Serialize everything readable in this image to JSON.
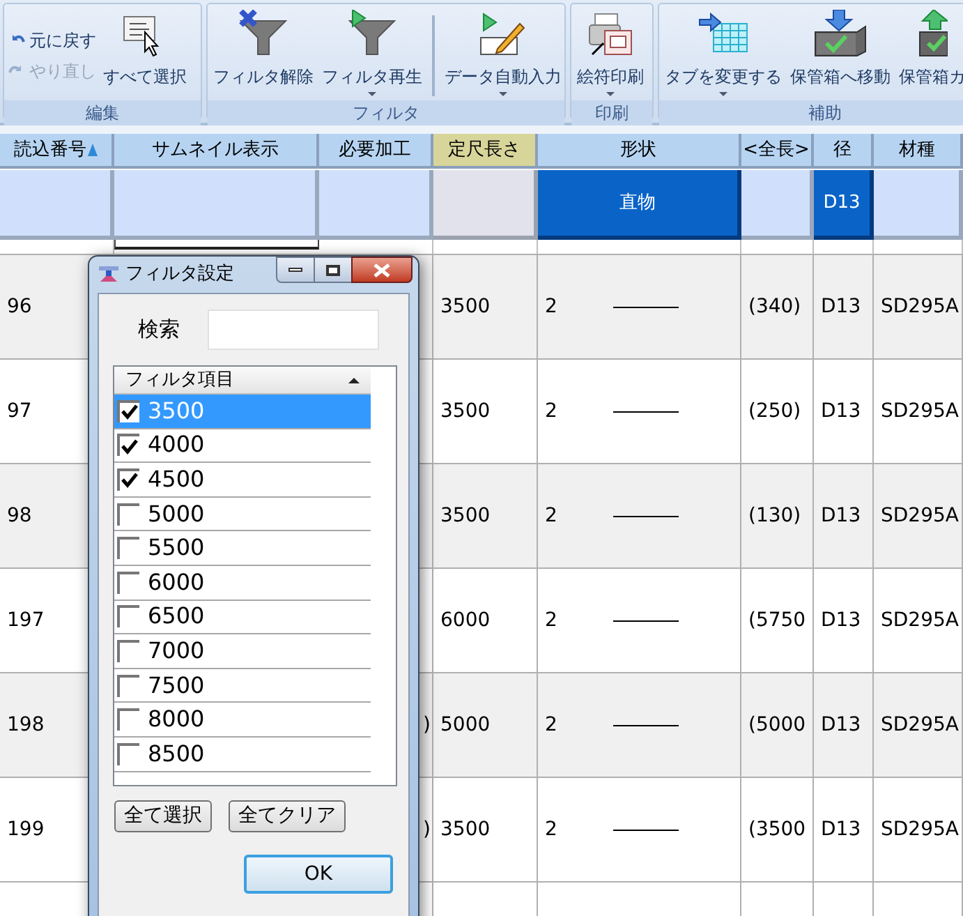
{
  "ribbon": {
    "groups": [
      {
        "label": "編集",
        "items": [
          {
            "label": "元に戻す",
            "kind": "small",
            "disabled": false
          },
          {
            "label": "やり直し",
            "kind": "small",
            "disabled": true
          },
          {
            "label": "すべて選択",
            "kind": "large",
            "dropdown": false
          }
        ]
      },
      {
        "label": "フィルタ",
        "items": [
          {
            "label": "フィルタ解除",
            "kind": "large",
            "dropdown": false
          },
          {
            "label": "フィルタ再生",
            "kind": "large",
            "dropdown": true
          },
          {
            "label": "データ自動入力",
            "kind": "large",
            "dropdown": true,
            "separator": true
          }
        ]
      },
      {
        "label": "印刷",
        "items": [
          {
            "label": "絵符印刷",
            "kind": "large",
            "dropdown": true
          }
        ]
      },
      {
        "label": "補助",
        "items": [
          {
            "label": "タブを変更する",
            "kind": "large",
            "dropdown": true
          },
          {
            "label": "保管箱へ移動",
            "kind": "large",
            "dropdown": false
          },
          {
            "label": "保管箱カ",
            "kind": "large",
            "dropdown": false
          }
        ]
      }
    ]
  },
  "table": {
    "columns": [
      {
        "label": "読込番号",
        "filtered": false,
        "sorted": true
      },
      {
        "label": "サムネイル表示",
        "filtered": false
      },
      {
        "label": "必要加工",
        "filtered": false
      },
      {
        "label": "定尺長さ",
        "filtered": true
      },
      {
        "label": "形状",
        "filtered": false
      },
      {
        "label": "<全長>",
        "filtered": false
      },
      {
        "label": "径",
        "filtered": false
      },
      {
        "label": "材種",
        "filtered": false
      }
    ],
    "filters": [
      {
        "selected": false
      },
      {
        "selected": false
      },
      {
        "selected": false
      },
      {
        "selected": false
      },
      {
        "value": "直物",
        "selected": true
      },
      {
        "selected": false
      },
      {
        "value": "D13",
        "selected": true
      },
      {
        "selected": false
      }
    ],
    "rows": [
      {
        "no": "96",
        "length": "3500",
        "shape": "2",
        "total": "(340)",
        "diameter": "D13",
        "material": "SD295A"
      },
      {
        "no": "97",
        "length": "3500",
        "shape": "2",
        "total": "(250)",
        "diameter": "D13",
        "material": "SD295A"
      },
      {
        "no": "98",
        "length": "3500",
        "shape": "2",
        "total": "(130)",
        "diameter": "D13",
        "material": "SD295A"
      },
      {
        "no": "197",
        "length": "6000",
        "shape": "2",
        "total": "(5750",
        "diameter": "D13",
        "material": "SD295A"
      },
      {
        "no": "198",
        "processing": ")",
        "length": "5000",
        "shape": "2",
        "total": "(5000",
        "diameter": "D13",
        "material": "SD295A"
      },
      {
        "no": "199",
        "processing": ")",
        "length": "3500",
        "shape": "2",
        "total": "(3500",
        "diameter": "D13",
        "material": "SD295A"
      }
    ]
  },
  "dialog": {
    "title": "フィルタ設定",
    "search": {
      "label": "検索"
    },
    "list": {
      "header": "フィルタ項目",
      "sort_ascending": true,
      "items": [
        {
          "label": "3500",
          "checked": true,
          "selected": true
        },
        {
          "label": "4000",
          "checked": true,
          "selected": false
        },
        {
          "label": "4500",
          "checked": true,
          "selected": false
        },
        {
          "label": "5000",
          "checked": false,
          "selected": false
        },
        {
          "label": "5500",
          "checked": false,
          "selected": false
        },
        {
          "label": "6000",
          "checked": false,
          "selected": false
        },
        {
          "label": "6500",
          "checked": false,
          "selected": false
        },
        {
          "label": "7000",
          "checked": false,
          "selected": false
        },
        {
          "label": "7500",
          "checked": false,
          "selected": false
        },
        {
          "label": "8000",
          "checked": false,
          "selected": false
        },
        {
          "label": "8500",
          "checked": false,
          "selected": false
        }
      ]
    },
    "buttons": [
      {
        "label": "全て選択",
        "default": false
      },
      {
        "label": "全てクリア",
        "default": false
      },
      {
        "label": "OK",
        "default": true
      }
    ]
  }
}
